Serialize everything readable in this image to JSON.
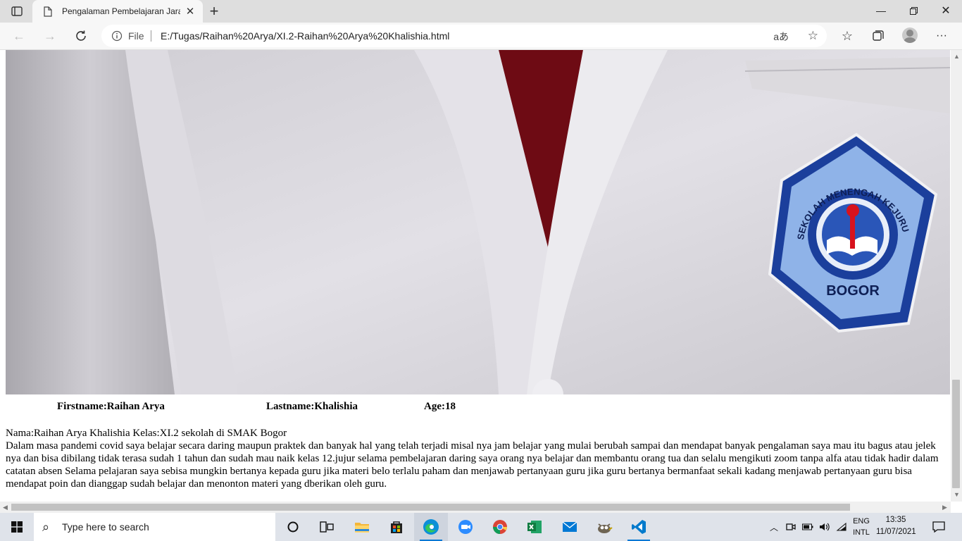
{
  "browser": {
    "tab_title": "Pengalaman Pembelajaran Jarak",
    "address_prefix": "File",
    "url": "E:/Tugas/Raihan%20Arya/XI.2-Raihan%20Arya%20Khalishia.html",
    "read_aloud": "aあ"
  },
  "page": {
    "firstname": "Firstname:Raihan Arya",
    "lastname": "Lastname:Khalishia",
    "age": "Age:18",
    "identity": "Nama:Raihan Arya Khalishia Kelas:XI.2 sekolah di SMAK Bogor",
    "story": "Dalam masa pandemi covid saya belajar secara daring maupun praktek dan banyak hal yang telah terjadi misal nya jam belajar yang mulai berubah sampai dan mendapat banyak pengalaman saya mau itu bagus atau jelek nya dan bisa dibilang tidak terasa sudah 1 tahun dan sudah mau naik kelas 12.jujur selama pembelajaran daring saya orang nya belajar dan membantu orang tua dan selalu mengikuti zoom tanpa alfa atau tidak hadir dalam catatan absen Selama pelajaran saya sebisa mungkin bertanya kepada guru jika materi belo terlalu paham dan menjawab pertanyaan guru jika guru bertanya bermanfaat sekali kadang menjawab pertanyaan guru bisa mendapat poin dan dianggap sudah belajar dan menonton materi yang dberikan oleh guru.",
    "badge_top": "SEKOLAH MENENGAH KEJURUAN-SMAK",
    "badge_bottom": "BOGOR"
  },
  "taskbar": {
    "search_placeholder": "Type here to search",
    "lang_1": "ENG",
    "lang_2": "INTL",
    "time": "13:35",
    "date": "11/07/2021"
  },
  "colors": {
    "edge_blue": "#0078d4",
    "jacket": "#d9d7dd",
    "tie": "#7a0e16",
    "badge_blue": "#1b3f9c"
  }
}
